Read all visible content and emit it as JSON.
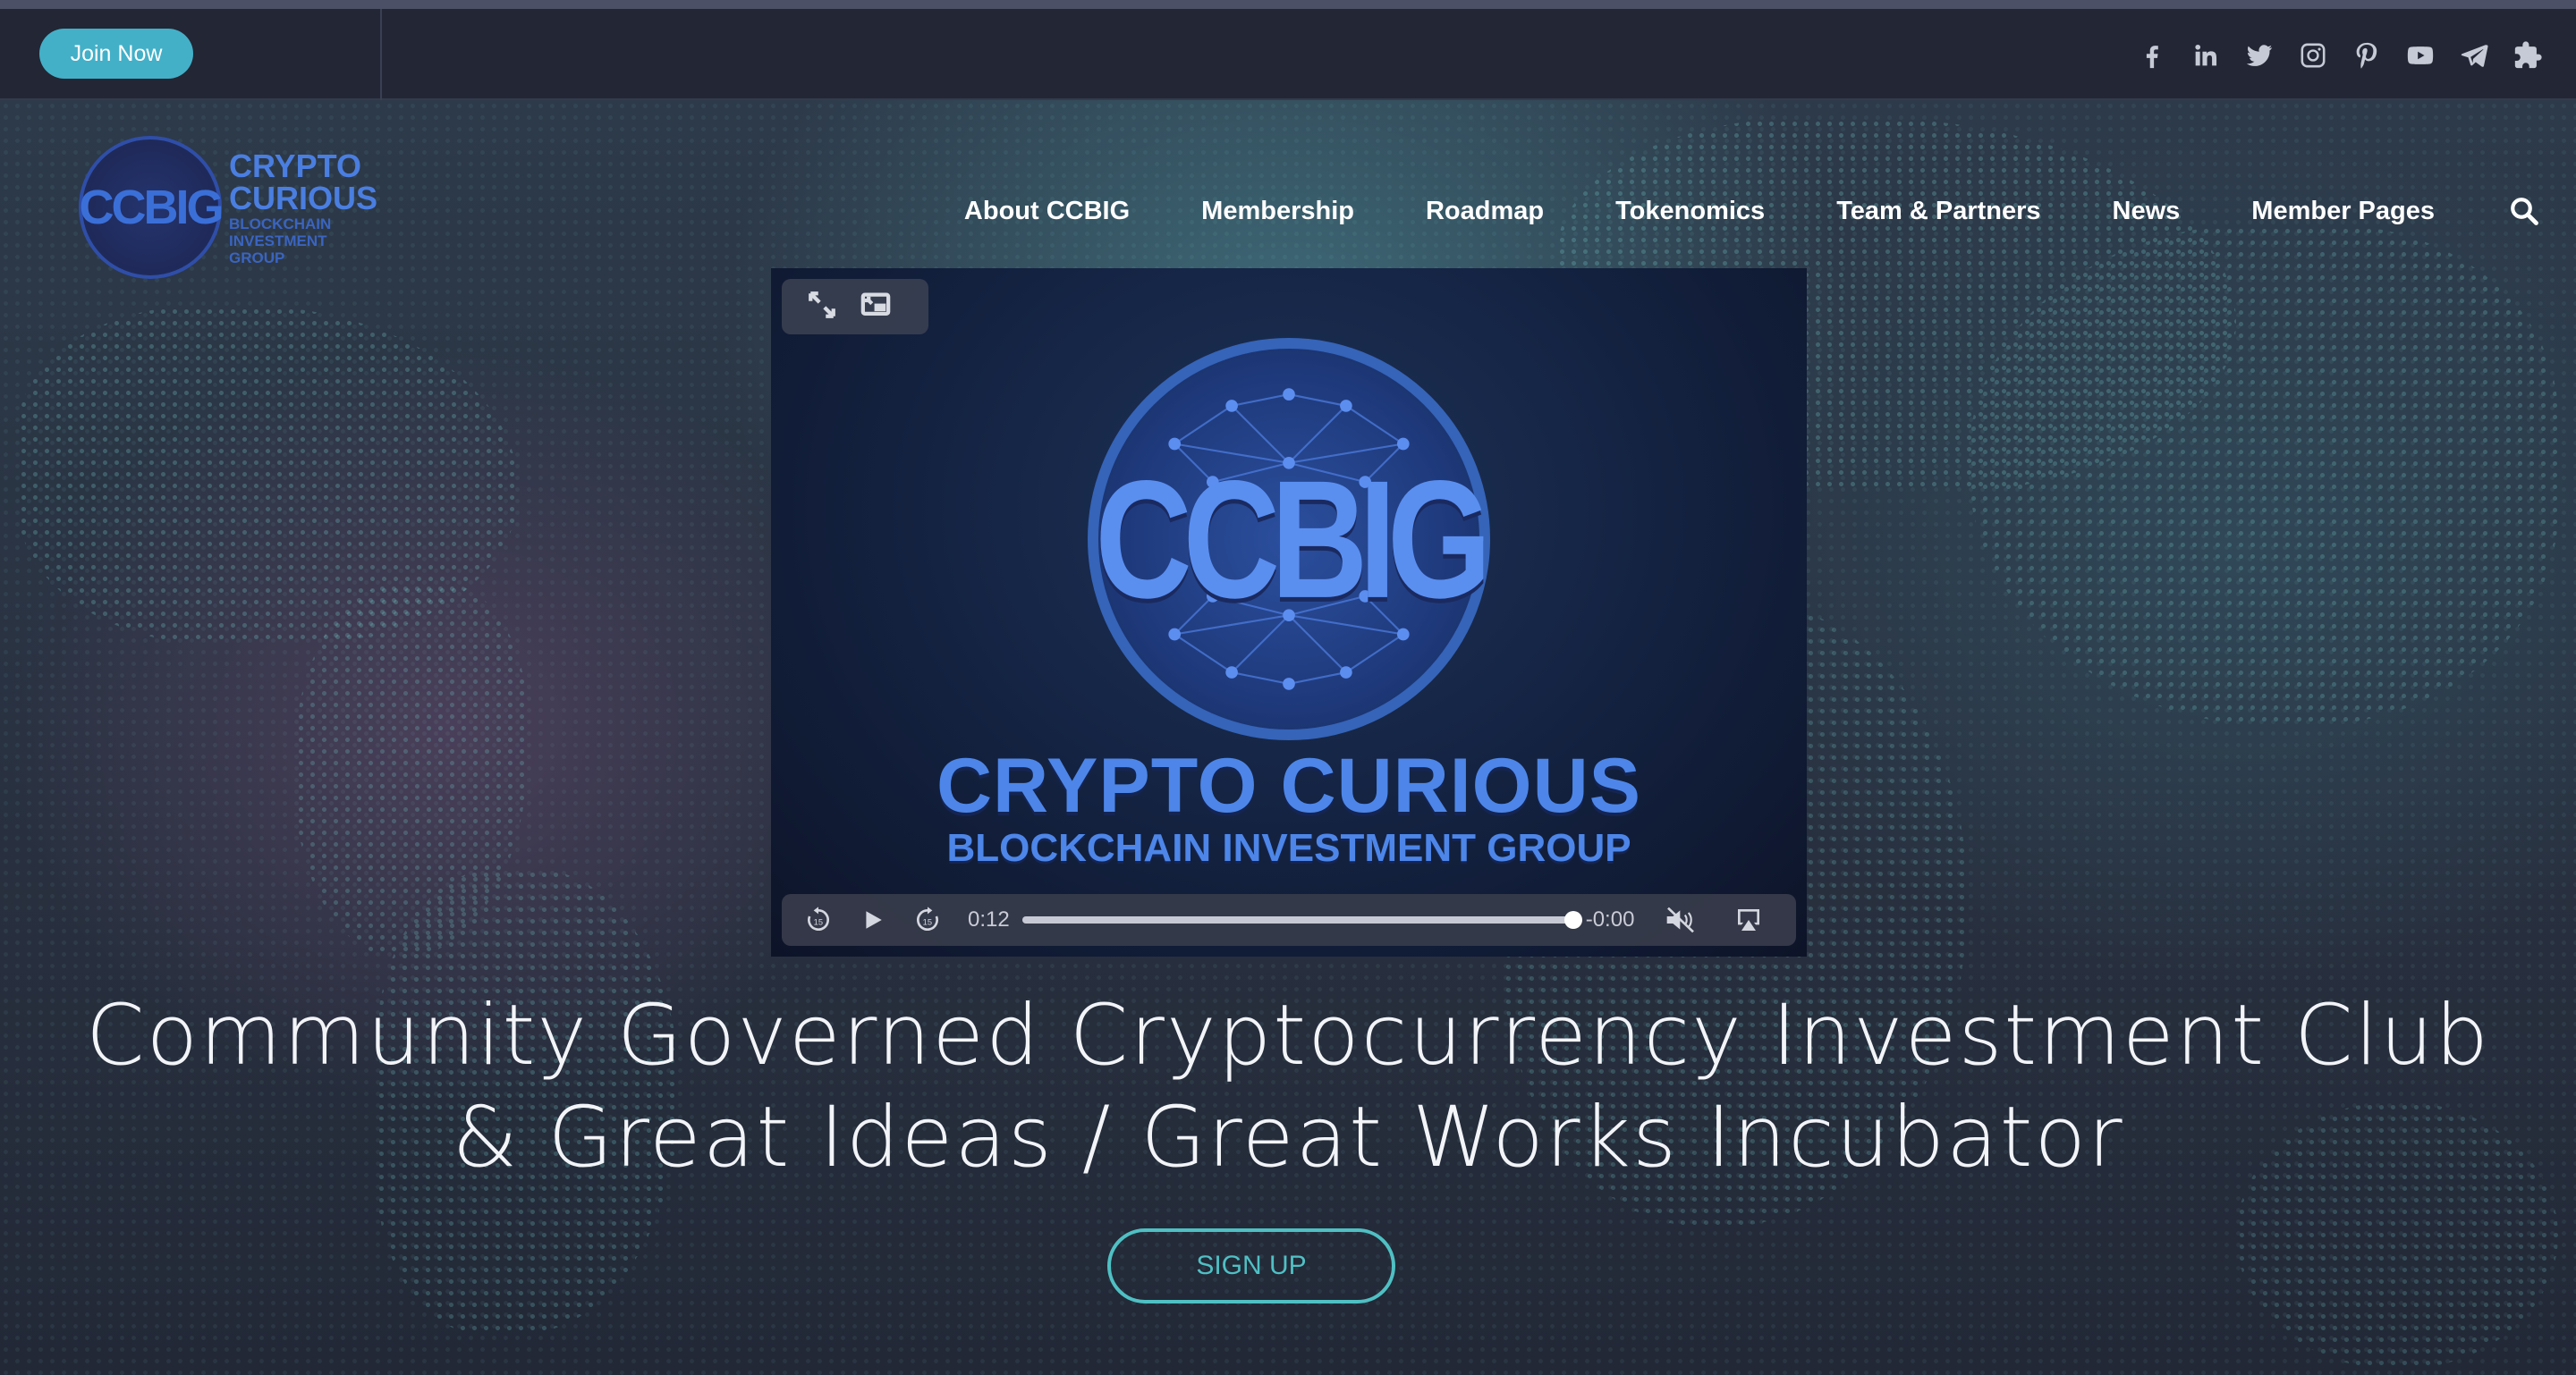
{
  "topbar": {
    "join_label": "Join Now",
    "social_icons": [
      "facebook-icon",
      "linkedin-icon",
      "twitter-icon",
      "instagram-icon",
      "pinterest-icon",
      "youtube-icon",
      "telegram-icon",
      "puzzle-icon"
    ]
  },
  "logo": {
    "monogram": "CCBIG",
    "line1": "CRYPTO",
    "line2": "CURIOUS",
    "line3": "BLOCKCHAIN",
    "line4": "INVESTMENT",
    "line5": "GROUP"
  },
  "nav": {
    "items": [
      "About CCBIG",
      "Membership",
      "Roadmap",
      "Tokenomics",
      "Team & Partners",
      "News",
      "Member Pages"
    ],
    "search_icon": "search-icon"
  },
  "video": {
    "emblem_text": "CCBIG",
    "title": "CRYPTO CURIOUS",
    "subtitle": "BLOCKCHAIN INVESTMENT GROUP",
    "current_time": "0:12",
    "remaining_time": "-0:00",
    "progress": 1.0,
    "muted": true
  },
  "hero": {
    "headline_line1": "Community Governed Cryptocurrency Investment Club",
    "headline_line2": "& Great Ideas / Great Works Incubator",
    "signup_label": "SIGN UP"
  },
  "colors": {
    "accent": "#43b0c8",
    "signup_outline": "#4fc0c4",
    "brand_blue": "#4d86e8",
    "topbar_bg": "#232634"
  }
}
